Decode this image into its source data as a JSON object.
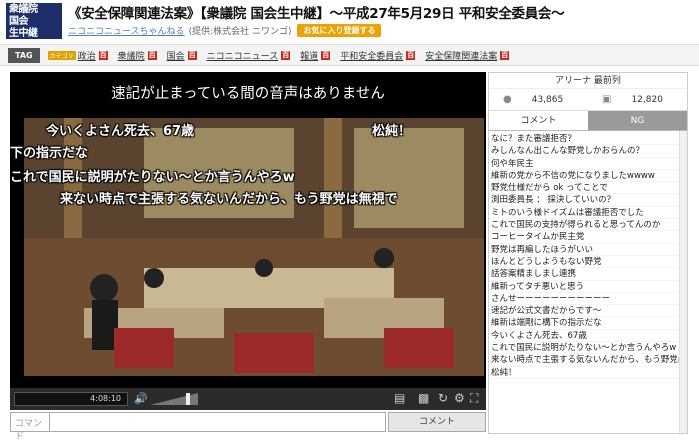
{
  "header": {
    "logo_lines": [
      "衆議院",
      "国会",
      "生中継"
    ],
    "title": "《安全保障関連法案》【衆議院 国会生中継】～平成27年5月29日 平和安全委員会～",
    "channel_name": "ニコニコニュースちゃんねる",
    "channel_owner": "(提供:株式会社 ニワンゴ)",
    "favorite_button": "お気に入り登録する"
  },
  "tags": {
    "label": "TAG",
    "items": [
      {
        "badge": "カテゴリ",
        "text": "政治"
      },
      {
        "badge": "",
        "text": "衆議院"
      },
      {
        "badge": "",
        "text": "国会"
      },
      {
        "badge": "",
        "text": "ニコニコニュース"
      },
      {
        "badge": "",
        "text": "報道"
      },
      {
        "badge": "",
        "text": "平和安全委員会"
      },
      {
        "badge": "",
        "text": "安全保障関連法案"
      }
    ],
    "dic_icon": "百"
  },
  "player": {
    "notice": "速記が止まっている間の音声はありません",
    "comments": [
      "今いくよさん死去、67歳",
      "松純！",
      "下の指示だな",
      "これで国民に説明がたりない～とか言うんやろw",
      "来ない時点で主張する気ないんだから、もう野党は無視で"
    ],
    "time": "4:08:10",
    "icons": [
      "volume-icon",
      "comment-toggle-icon",
      "screen-size-icon",
      "reload-icon",
      "settings-icon",
      "fullscreen-icon"
    ]
  },
  "comment_input": {
    "placeholder": "コマンド",
    "post_label": "コメント"
  },
  "panel": {
    "arena": "アリーナ 最前列",
    "viewers": "43,865",
    "comments": "12,820",
    "tab_comment": "コメント",
    "tab_ng": "NG",
    "comment_list": [
      "なに？また審議拒否？",
      "みしんなん出こんな野党しかおらんの？",
      "何や年民主",
      "維新の党から不信の党になりましたwwww",
      "野党仕様だから ok ってことで",
      "渕田委員長 ： 採決していいの？",
      "ミトのいう様ドイズムは審議拒否でした",
      "これで国民の支持が得られると思ってんのか",
      "コーヒータイムか民主党",
      "野党は再編したほうがいい",
      "ほんとどうしようもない野党",
      "話答案精ましまし連携",
      "維新ってタチ悪いと思う",
      "さんせーーーーーーーーーーー",
      "速記が公式文書だからです～",
      "維新は端剛に構下の指示だな",
      "今いくよさん死去、67歳",
      "これで国民に説明がたりない～とか言うんやろw",
      "来ない時点で主張する気ないんだから、もう野党は無",
      "松純！"
    ]
  }
}
